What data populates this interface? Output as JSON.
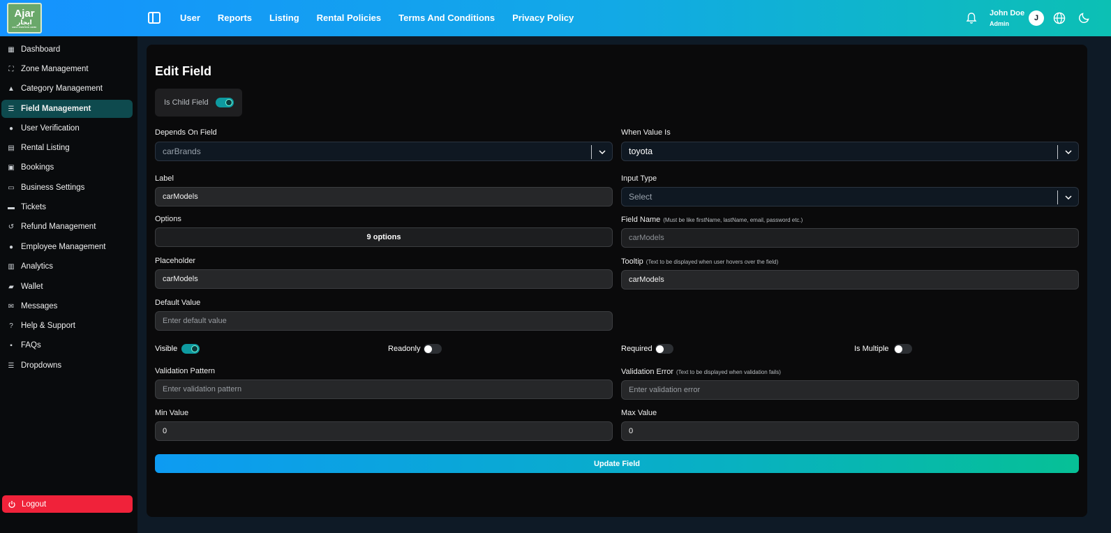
{
  "logo": {
    "line1": "Ajar",
    "line2": "ايجار",
    "line3": "BEST RENTING HERE"
  },
  "topnav": [
    "User",
    "Reports",
    "Listing",
    "Rental Policies",
    "Terms And Conditions",
    "Privacy Policy"
  ],
  "user": {
    "name": "John Doe",
    "role": "Admin",
    "initial": "J"
  },
  "sidebar": {
    "items": [
      {
        "label": "Dashboard",
        "icon": "grid-icon"
      },
      {
        "label": "Zone Management",
        "icon": "zone-icon"
      },
      {
        "label": "Category Management",
        "icon": "shapes-icon"
      },
      {
        "label": "Field Management",
        "icon": "sliders-icon",
        "active": true
      },
      {
        "label": "User Verification",
        "icon": "users-icon"
      },
      {
        "label": "Rental Listing",
        "icon": "clipboard-icon"
      },
      {
        "label": "Bookings",
        "icon": "calendar-icon"
      },
      {
        "label": "Business Settings",
        "icon": "card-icon"
      },
      {
        "label": "Tickets",
        "icon": "ticket-icon"
      },
      {
        "label": "Refund Management",
        "icon": "undo-icon"
      },
      {
        "label": "Employee Management",
        "icon": "team-icon"
      },
      {
        "label": "Analytics",
        "icon": "chart-icon"
      },
      {
        "label": "Wallet",
        "icon": "wallet-icon"
      },
      {
        "label": "Messages",
        "icon": "mail-icon"
      },
      {
        "label": "Help & Support",
        "icon": "question-icon"
      },
      {
        "label": "FAQs",
        "icon": "faq-icon"
      },
      {
        "label": "Dropdowns",
        "icon": "list-icon"
      }
    ],
    "logout": "Logout"
  },
  "form": {
    "title": "Edit Field",
    "is_child_label": "Is Child Field",
    "depends_on_label": "Depends On Field",
    "depends_on_value": "carBrands",
    "when_value_label": "When Value Is",
    "when_value_value": "toyota",
    "label_label": "Label",
    "label_value": "carModels",
    "input_type_label": "Input Type",
    "input_type_value": "Select",
    "options_label": "Options",
    "options_button": "9 options",
    "field_name_label": "Field Name",
    "field_name_hint": "(Must be like firstName, lastName, email, password etc.)",
    "field_name_value": "carModels",
    "placeholder_label": "Placeholder",
    "placeholder_value": "carModels",
    "tooltip_label": "Tooltip",
    "tooltip_hint": "(Text to be displayed when user hovers over the field)",
    "tooltip_value": "carModels",
    "default_label": "Default Value",
    "default_placeholder": "Enter default value",
    "visible_label": "Visible",
    "readonly_label": "Readonly",
    "required_label": "Required",
    "multiple_label": "Is Multiple",
    "validation_pattern_label": "Validation Pattern",
    "validation_pattern_placeholder": "Enter validation pattern",
    "validation_error_label": "Validation Error",
    "validation_error_hint": "(Text to be displayed when validation fails)",
    "validation_error_placeholder": "Enter validation error",
    "min_label": "Min Value",
    "min_value": "0",
    "max_label": "Max Value",
    "max_value": "0",
    "update_button": "Update Field",
    "toggles": {
      "is_child": true,
      "visible": true,
      "readonly": false,
      "required": false,
      "multiple": false
    }
  }
}
